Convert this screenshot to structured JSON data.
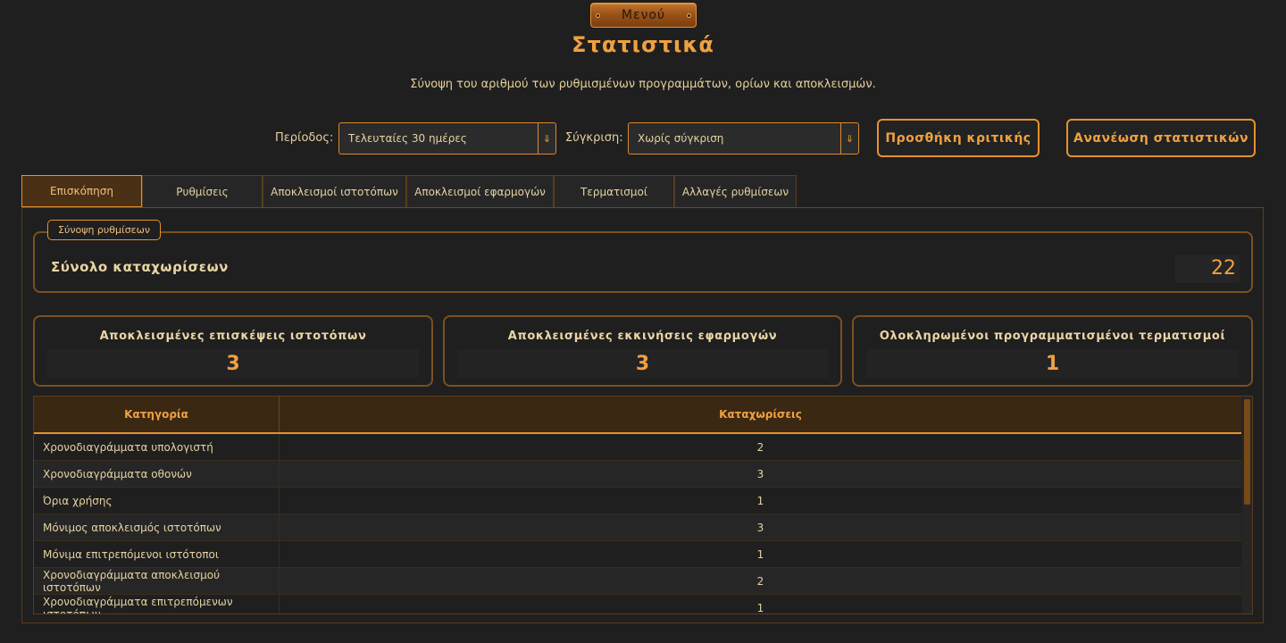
{
  "menu": {
    "label": "Μενού"
  },
  "header": {
    "title": "Στατιστικά",
    "subtitle": "Σύνοψη του αριθμού των ρυθμισμένων προγραμμάτων, ορίων και αποκλεισμών."
  },
  "controls": {
    "period_label": "Περίοδος:",
    "period_value": "Τελευταίες 30 ημέρες",
    "compare_label": "Σύγκριση:",
    "compare_value": "Χωρίς σύγκριση",
    "add_review_label": "Προσθήκη κριτικής",
    "refresh_label": "Ανανέωση στατιστικών"
  },
  "tabs": [
    {
      "label": "Επισκόπηση",
      "active": true
    },
    {
      "label": "Ρυθμίσεις",
      "active": false
    },
    {
      "label": "Αποκλεισμοί ιστοτόπων",
      "active": false
    },
    {
      "label": "Αποκλεισμοί εφαρμογών",
      "active": false
    },
    {
      "label": "Τερματισμοί",
      "active": false
    },
    {
      "label": "Αλλαγές ρυθμίσεων",
      "active": false
    }
  ],
  "summary": {
    "legend": "Σύνοψη ρυθμίσεων",
    "total_label": "Σύνολο καταχωρίσεων",
    "total_value": "22"
  },
  "cards": [
    {
      "title": "Αποκλεισμένες επισκέψεις ιστοτόπων",
      "value": "3"
    },
    {
      "title": "Αποκλεισμένες εκκινήσεις εφαρμογών",
      "value": "3"
    },
    {
      "title": "Ολοκληρωμένοι προγραμματισμένοι τερματισμοί",
      "value": "1"
    }
  ],
  "table": {
    "columns": [
      "Κατηγορία",
      "Καταχωρίσεις"
    ],
    "rows": [
      [
        "Χρονοδιαγράμματα υπολογιστή",
        "2"
      ],
      [
        "Χρονοδιαγράμματα οθονών",
        "3"
      ],
      [
        "Όρια χρήσης",
        "1"
      ],
      [
        "Μόνιμος αποκλεισμός ιστοτόπων",
        "3"
      ],
      [
        "Μόνιμα επιτρεπόμενοι ιστότοποι",
        "1"
      ],
      [
        "Χρονοδιαγράμματα αποκλεισμού ιστοτόπων",
        "2"
      ],
      [
        "Χρονοδιαγράμματα επιτρεπόμενων ιστοτόπων",
        "1"
      ]
    ]
  },
  "colors": {
    "accent": "#f0a040",
    "border": "#e8902e",
    "background": "#1f1f1f"
  },
  "icons": {
    "dropdown": "chevron-down-icon"
  }
}
